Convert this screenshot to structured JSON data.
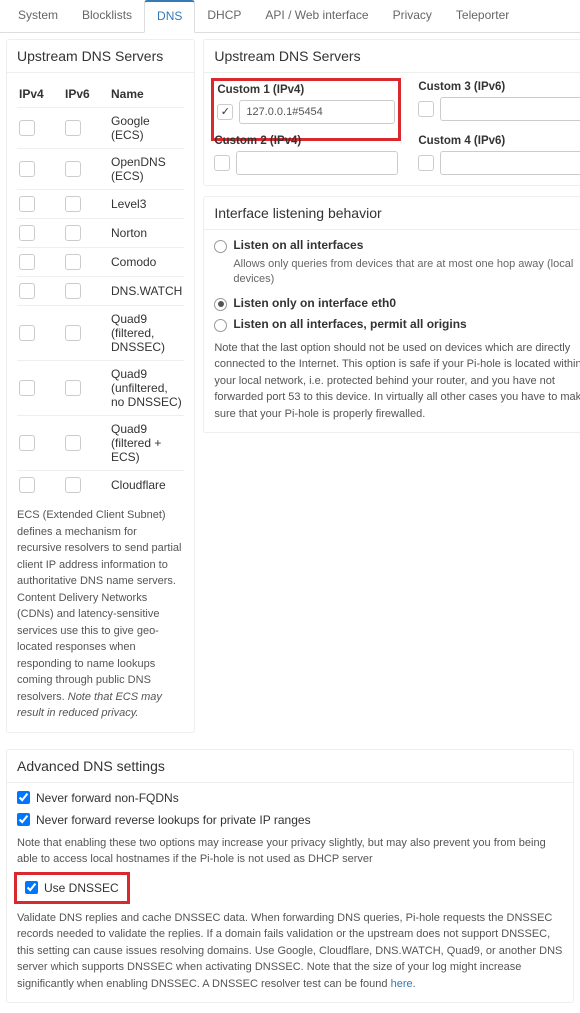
{
  "tabs": {
    "system": "System",
    "blocklists": "Blocklists",
    "dns": "DNS",
    "dhcp": "DHCP",
    "api": "API / Web interface",
    "privacy": "Privacy",
    "teleporter": "Teleporter"
  },
  "upstream_left": {
    "heading": "Upstream DNS Servers",
    "cols": {
      "ipv4": "IPv4",
      "ipv6": "IPv6",
      "name": "Name"
    },
    "providers": [
      "Google (ECS)",
      "OpenDNS (ECS)",
      "Level3",
      "Norton",
      "Comodo",
      "DNS.WATCH",
      "Quad9 (filtered, DNSSEC)",
      "Quad9 (unfiltered, no DNSSEC)",
      "Quad9 (filtered + ECS)",
      "Cloudflare"
    ],
    "note_plain": "ECS (Extended Client Subnet) defines a mechanism for recursive resolvers to send partial client IP address information to authoritative DNS name servers. Content Delivery Networks (CDNs) and latency-sensitive services use this to give geo-located responses when responding to name lookups coming through public DNS resolvers. ",
    "note_em": "Note that ECS may result in reduced privacy."
  },
  "upstream_right": {
    "heading": "Upstream DNS Servers",
    "custom1_label": "Custom 1 (IPv4)",
    "custom1_value": "127.0.0.1#5454",
    "custom1_checked": true,
    "custom3_label": "Custom 3 (IPv6)",
    "custom2_label": "Custom 2 (IPv4)",
    "custom4_label": "Custom 4 (IPv6)"
  },
  "iface": {
    "heading": "Interface listening behavior",
    "opt_all": "Listen on all interfaces",
    "opt_all_desc": "Allows only queries from devices that are at most one hop away (local devices)",
    "opt_eth0": "Listen only on interface eth0",
    "opt_permit": "Listen on all interfaces, permit all origins",
    "note": "Note that the last option should not be used on devices which are directly connected to the Internet. This option is safe if your Pi-hole is located within your local network, i.e. protected behind your router, and you have not forwarded port 53 to this device. In virtually all other cases you have to make sure that your Pi-hole is properly firewalled."
  },
  "adv": {
    "heading": "Advanced DNS settings",
    "never_fqdn": "Never forward non-FQDNs",
    "never_reverse": "Never forward reverse lookups for private IP ranges",
    "note1": "Note that enabling these two options may increase your privacy slightly, but may also prevent you from being able to access local hostnames if the Pi-hole is not used as DHCP server",
    "use_dnssec": "Use DNSSEC",
    "note2_a": "Validate DNS replies and cache DNSSEC data. When forwarding DNS queries, Pi-hole requests the DNSSEC records needed to validate the replies. If a domain fails validation or the upstream does not support DNSSEC, this setting can cause issues resolving domains. Use Google, Cloudflare, DNS.WATCH, Quad9, or another DNS server which supports DNSSEC when activating DNSSEC. Note that the size of your log might increase significantly when enabling DNSSEC. A DNSSEC resolver test can be found ",
    "note2_link": "here",
    "note2_b": "."
  }
}
